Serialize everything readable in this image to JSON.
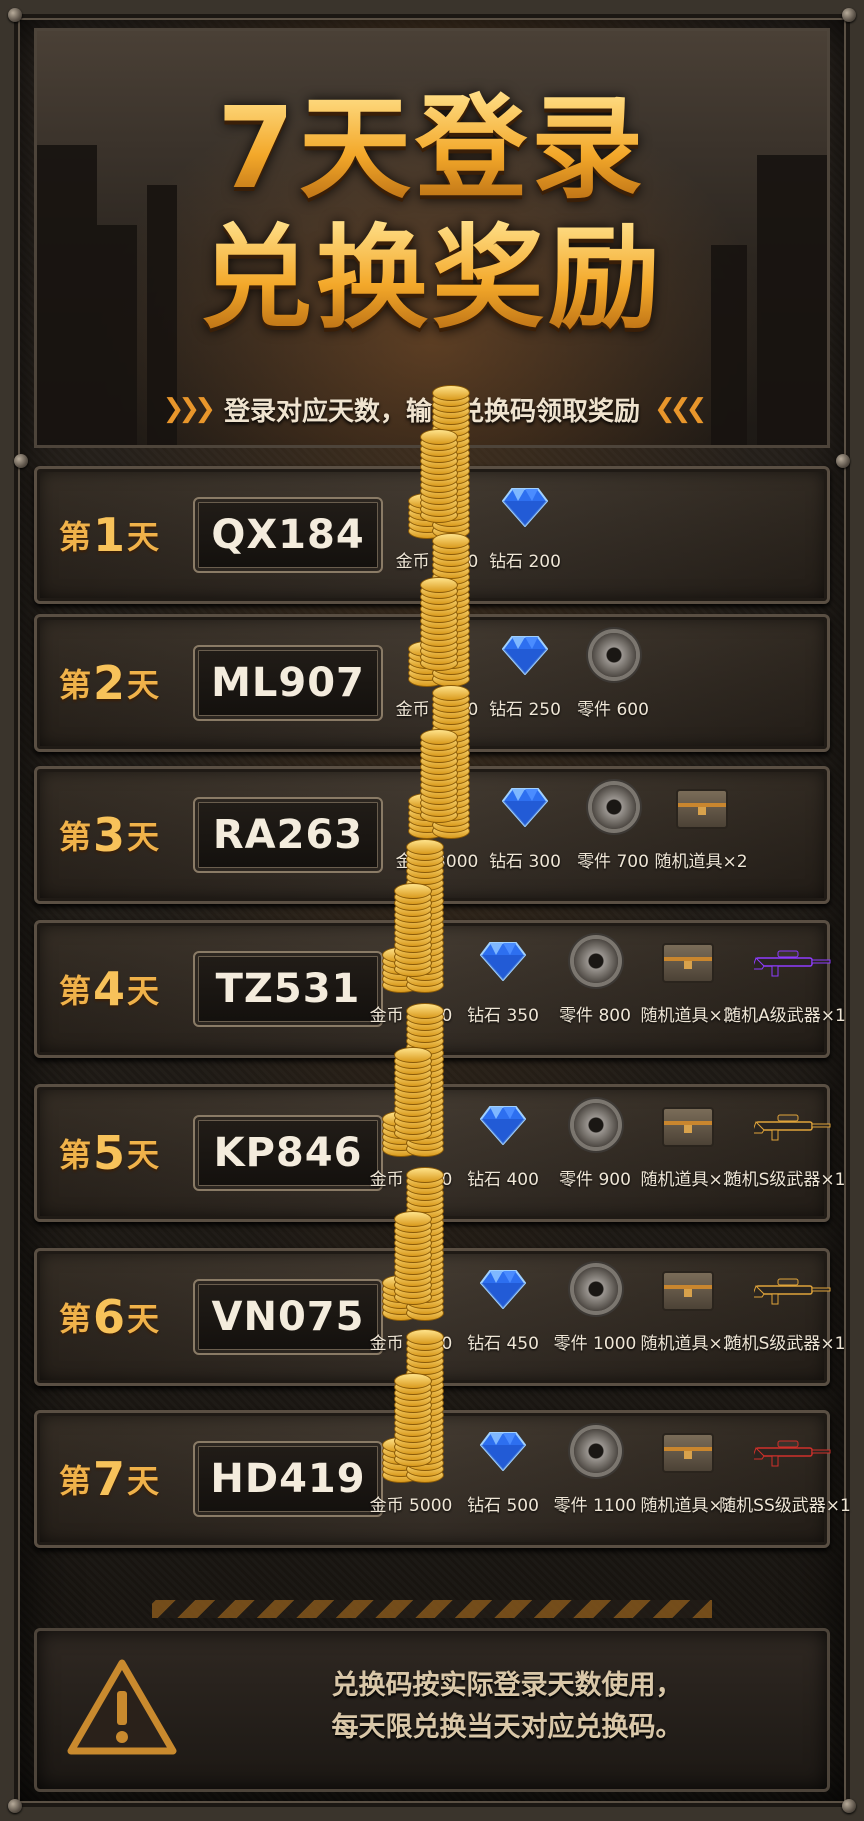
{
  "header": {
    "title_line1": "7天登录",
    "title_line2": "兑换奖励",
    "subtitle": "登录对应天数，输入兑换码领取奖励"
  },
  "colors": {
    "accent": "#f0b24a",
    "panel": "#2a231c",
    "text": "#efe6d6"
  },
  "days": [
    {
      "prefix": "第",
      "num": "1",
      "suffix": "天",
      "code": "QX184",
      "rewards": [
        {
          "icon": "coin-stack-icon",
          "label": "金币 2000"
        },
        {
          "icon": "diamond-icon",
          "label": "钻石 200"
        }
      ]
    },
    {
      "prefix": "第",
      "num": "2",
      "suffix": "天",
      "code": "ML907",
      "rewards": [
        {
          "icon": "coin-stack-icon",
          "label": "金币 2500"
        },
        {
          "icon": "diamond-icon",
          "label": "钻石 250"
        },
        {
          "icon": "gear-icon",
          "label": "零件 600"
        }
      ]
    },
    {
      "prefix": "第",
      "num": "3",
      "suffix": "天",
      "code": "RA263",
      "rewards": [
        {
          "icon": "coin-stack-icon",
          "label": "金币 3000"
        },
        {
          "icon": "diamond-icon",
          "label": "钻石 300"
        },
        {
          "icon": "gear-icon",
          "label": "零件 700"
        },
        {
          "icon": "chest-icon",
          "label": "随机道具×2"
        }
      ]
    },
    {
      "prefix": "第",
      "num": "4",
      "suffix": "天",
      "code": "TZ531",
      "rewards": [
        {
          "icon": "coin-stack-icon",
          "label": "金币 3500"
        },
        {
          "icon": "diamond-icon",
          "label": "钻石 350"
        },
        {
          "icon": "gear-icon",
          "label": "零件 800"
        },
        {
          "icon": "chest-icon",
          "label": "随机道具×2"
        },
        {
          "icon": "rifle-purple-icon",
          "label": "随机A级武器×1"
        }
      ]
    },
    {
      "prefix": "第",
      "num": "5",
      "suffix": "天",
      "code": "KP846",
      "rewards": [
        {
          "icon": "coin-stack-icon",
          "label": "金币 4000"
        },
        {
          "icon": "diamond-icon",
          "label": "钻石 400"
        },
        {
          "icon": "gear-icon",
          "label": "零件 900"
        },
        {
          "icon": "chest-icon",
          "label": "随机道具×2"
        },
        {
          "icon": "rifle-gold-icon",
          "label": "随机S级武器×1"
        }
      ]
    },
    {
      "prefix": "第",
      "num": "6",
      "suffix": "天",
      "code": "VN075",
      "rewards": [
        {
          "icon": "coin-stack-icon",
          "label": "金币 4500"
        },
        {
          "icon": "diamond-icon",
          "label": "钻石 450"
        },
        {
          "icon": "gear-icon",
          "label": "零件 1000"
        },
        {
          "icon": "chest-icon",
          "label": "随机道具×2"
        },
        {
          "icon": "rifle-gold-icon",
          "label": "随机S级武器×1"
        }
      ]
    },
    {
      "prefix": "第",
      "num": "7",
      "suffix": "天",
      "code": "HD419",
      "rewards": [
        {
          "icon": "coin-stack-icon",
          "label": "金币 5000"
        },
        {
          "icon": "diamond-icon",
          "label": "钻石 500"
        },
        {
          "icon": "gear-icon",
          "label": "零件 1100"
        },
        {
          "icon": "chest-icon",
          "label": "随机道具×2"
        },
        {
          "icon": "rifle-red-icon",
          "label": "随机SS级武器×1"
        }
      ]
    }
  ],
  "footer": {
    "notice_line1": "兑换码按实际登录天数使用，",
    "notice_line2": "每天限兑换当天对应兑换码。"
  }
}
